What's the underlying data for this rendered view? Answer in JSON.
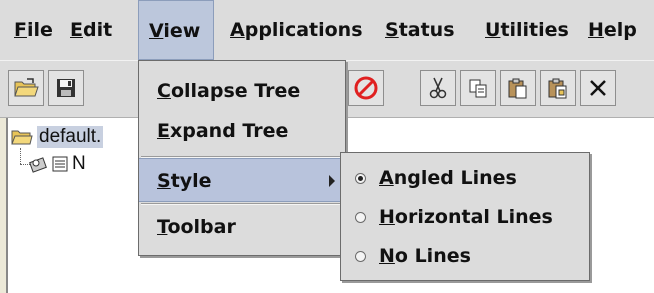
{
  "menubar": {
    "items": [
      {
        "label": "File"
      },
      {
        "label": "Edit"
      },
      {
        "label": "View"
      },
      {
        "label": "Applications"
      },
      {
        "label": "Status"
      },
      {
        "label": "Utilities"
      },
      {
        "label": "Help"
      }
    ]
  },
  "toolbar": {
    "buttons": [
      "open-folder-icon",
      "save-icon",
      "stop-icon",
      "cut-icon",
      "copy-icon",
      "paste-icon",
      "paste-special-icon",
      "delete-icon"
    ]
  },
  "tree": {
    "root_label": "default.",
    "child_label": "N"
  },
  "view_menu": {
    "items": [
      {
        "label": "Collapse Tree"
      },
      {
        "label": "Expand Tree"
      },
      {
        "label": "Style"
      },
      {
        "label": "Toolbar"
      }
    ]
  },
  "style_submenu": {
    "items": [
      {
        "label": "Angled Lines",
        "selected": true
      },
      {
        "label": "Horizontal Lines",
        "selected": false
      },
      {
        "label": "No Lines",
        "selected": false
      }
    ]
  },
  "colors": {
    "menu_bg": "#dcdcdc",
    "highlight": "#b8c3dc",
    "stop_red": "#e02020"
  }
}
